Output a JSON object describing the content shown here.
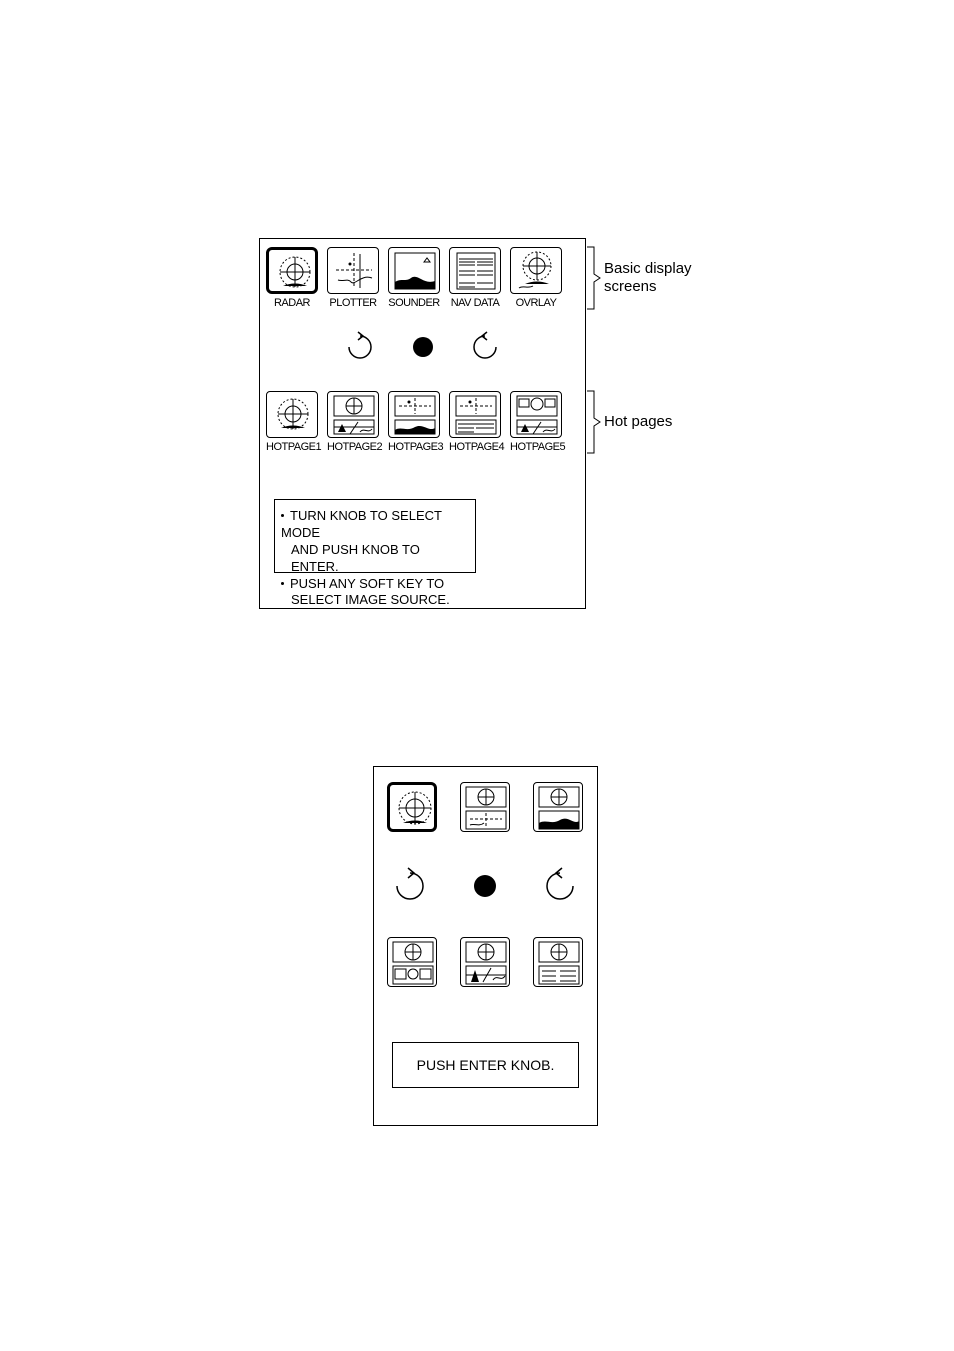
{
  "top_screen": {
    "row1_labels": [
      "RADAR",
      "PLOTTER",
      "SOUNDER",
      "NAV DATA",
      "OVRLAY"
    ],
    "row2_labels": [
      "HOTPAGE1",
      "HOTPAGE2",
      "HOTPAGE3",
      "HOTPAGE4",
      "HOTPAGE5"
    ],
    "side_label_row1_line1": "Basic display",
    "side_label_row1_line2": "screens",
    "side_label_row2": "Hot pages",
    "info_line1a": "TURN KNOB TO SELECT MODE",
    "info_line1b": "AND PUSH KNOB TO ENTER.",
    "info_line2a": "PUSH ANY SOFT KEY TO",
    "info_line2b": "SELECT IMAGE SOURCE."
  },
  "bottom_screen": {
    "push_label": "PUSH ENTER KNOB."
  }
}
